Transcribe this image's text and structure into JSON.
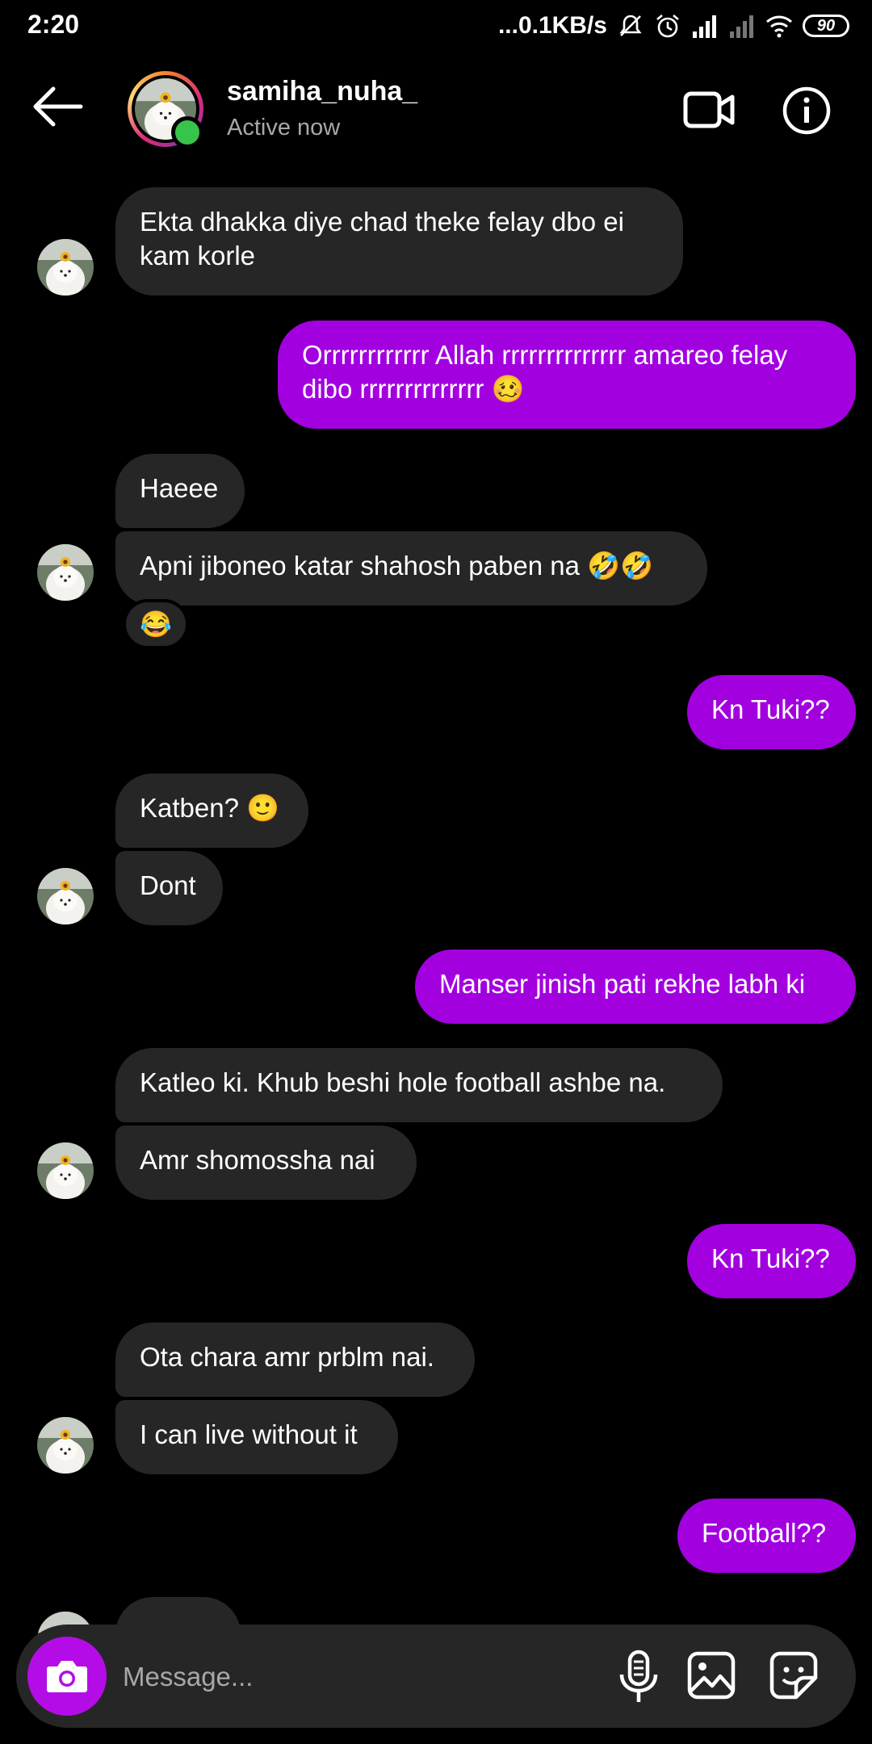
{
  "status_bar": {
    "time": "2:20",
    "network_speed": "...0.1KB/s",
    "battery": "90"
  },
  "header": {
    "username": "samiha_nuha_",
    "status": "Active now"
  },
  "messages": [
    {
      "dir": "in",
      "text": "Ekta dhakka diye chad theke felay dbo ei kam korle"
    },
    {
      "dir": "out",
      "text": "Orrrrrrrrrrrr Allah rrrrrrrrrrrrrr amareo felay dibo rrrrrrrrrrrrrr 🥴"
    },
    {
      "dir": "in",
      "text": "Haeee"
    },
    {
      "dir": "in",
      "text": "Apni jiboneo katar shahosh paben na 🤣🤣",
      "reaction": "😂"
    },
    {
      "dir": "out",
      "text": "Kn Tuki??"
    },
    {
      "dir": "in",
      "text": "Katben? 🙂"
    },
    {
      "dir": "in",
      "text": "Dont"
    },
    {
      "dir": "out",
      "text": "Manser jinish pati rekhe labh ki"
    },
    {
      "dir": "in",
      "text": "Katleo ki. Khub beshi hole football ashbe na."
    },
    {
      "dir": "in",
      "text": "Amr shomossha nai"
    },
    {
      "dir": "out",
      "text": "Kn Tuki??"
    },
    {
      "dir": "in",
      "text": "Ota chara amr prblm nai."
    },
    {
      "dir": "in",
      "text": "I can live without it"
    },
    {
      "dir": "out",
      "text": "Football??"
    }
  ],
  "composer": {
    "placeholder": "Message..."
  },
  "colors": {
    "outgoing": "#a300e0",
    "incoming": "#262626",
    "online": "#37c44a",
    "camera": "#b40ce6"
  },
  "icons": [
    "back-arrow-icon",
    "video-call-icon",
    "info-icon",
    "camera-icon",
    "microphone-icon",
    "gallery-icon",
    "sticker-icon"
  ]
}
